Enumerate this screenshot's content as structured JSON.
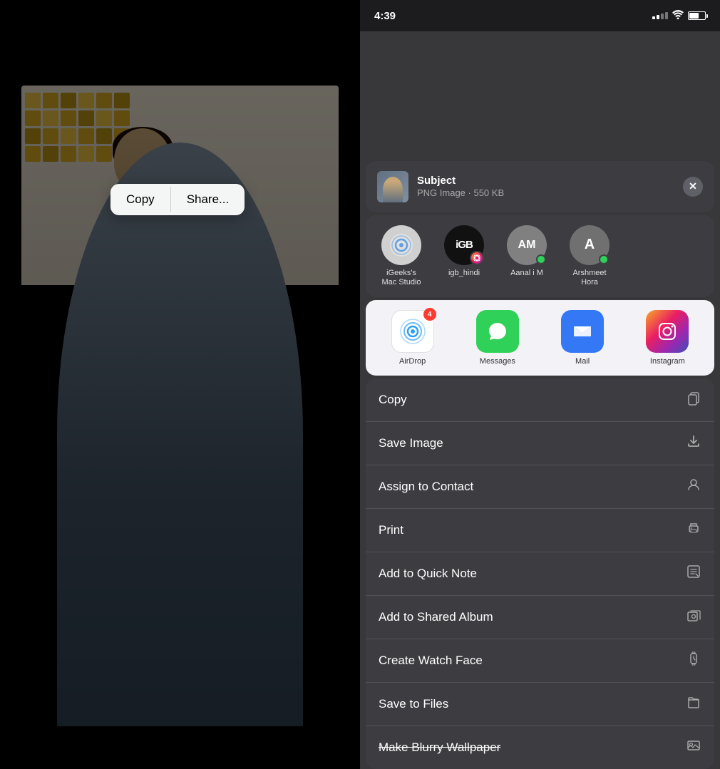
{
  "left": {
    "popup": {
      "copy_label": "Copy",
      "share_label": "Share..."
    }
  },
  "right": {
    "status_bar": {
      "time": "4:39",
      "signal": "...",
      "wifi": "wifi",
      "battery": "battery"
    },
    "sheet": {
      "header": {
        "title": "Subject",
        "subtitle": "PNG Image · 550 KB",
        "close_label": "✕"
      },
      "contacts": [
        {
          "id": "mac-studio",
          "label": "iGeeks's\nMac Studio",
          "initials": "📡",
          "type": "airdrop"
        },
        {
          "id": "igb-hindi",
          "label": "igb_hindi",
          "initials": "iGB",
          "type": "igb"
        },
        {
          "id": "aanal",
          "label": "Aanal i M",
          "initials": "AM",
          "type": "aanal"
        },
        {
          "id": "arshmeet",
          "label": "Arshmeet\nHora",
          "initials": "A",
          "type": "arshmeet"
        }
      ],
      "apps": [
        {
          "id": "airdrop",
          "label": "AirDrop",
          "badge": "4"
        },
        {
          "id": "messages",
          "label": "Messages",
          "badge": null
        },
        {
          "id": "mail",
          "label": "Mail",
          "badge": null
        },
        {
          "id": "instagram",
          "label": "Instagram",
          "badge": null
        }
      ],
      "actions": [
        {
          "id": "copy",
          "label": "Copy",
          "icon": "📄"
        },
        {
          "id": "save-image",
          "label": "Save Image",
          "icon": "⬇"
        },
        {
          "id": "assign-contact",
          "label": "Assign to Contact",
          "icon": "👤"
        },
        {
          "id": "print",
          "label": "Print",
          "icon": "🖨"
        },
        {
          "id": "add-quick-note",
          "label": "Add to Quick Note",
          "icon": "📝"
        },
        {
          "id": "add-shared-album",
          "label": "Add to Shared Album",
          "icon": "🗂"
        },
        {
          "id": "create-watch-face",
          "label": "Create Watch Face",
          "icon": "⌚"
        },
        {
          "id": "save-files",
          "label": "Save to Files",
          "icon": "📁"
        },
        {
          "id": "make-blurry",
          "label": "Make Blurry Wallpaper",
          "icon": "🖼",
          "strikethrough": false
        }
      ]
    }
  }
}
